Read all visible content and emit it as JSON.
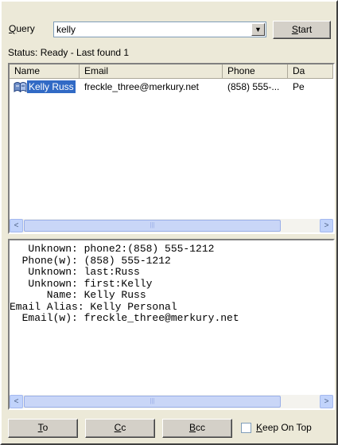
{
  "query": {
    "label_underlined": "Q",
    "label_rest": "uery",
    "value": "kelly",
    "dropdown_icon": "▼",
    "start_underlined": "S",
    "start_rest": "tart"
  },
  "status": "Status: Ready - Last found 1",
  "results": {
    "columns": [
      "Name",
      "Email",
      "Phone",
      "Da"
    ],
    "rows": [
      {
        "name": "Kelly Russ",
        "email": "freckle_three@merkury.net",
        "phone": "(858) 555-...",
        "extra": "Pe",
        "icon": "address-book-icon"
      }
    ]
  },
  "scroll": {
    "left": "<",
    "right": ">",
    "grip": "|||"
  },
  "details": {
    "lines": [
      "   Unknown: phone2:(858) 555-1212",
      "  Phone(w): (858) 555-1212",
      "   Unknown: last:Russ",
      "   Unknown: first:Kelly",
      "      Name: Kelly Russ",
      "Email Alias: Kelly Personal",
      "  Email(w): freckle_three@merkury.net"
    ]
  },
  "buttons": {
    "to_u": "T",
    "to_rest": "o",
    "cc_u": "C",
    "cc_rest": "c",
    "bcc_u": "B",
    "bcc_rest": "cc",
    "keep_u": "K",
    "keep_rest": "eep On Top",
    "keep_on_top_checked": false
  }
}
